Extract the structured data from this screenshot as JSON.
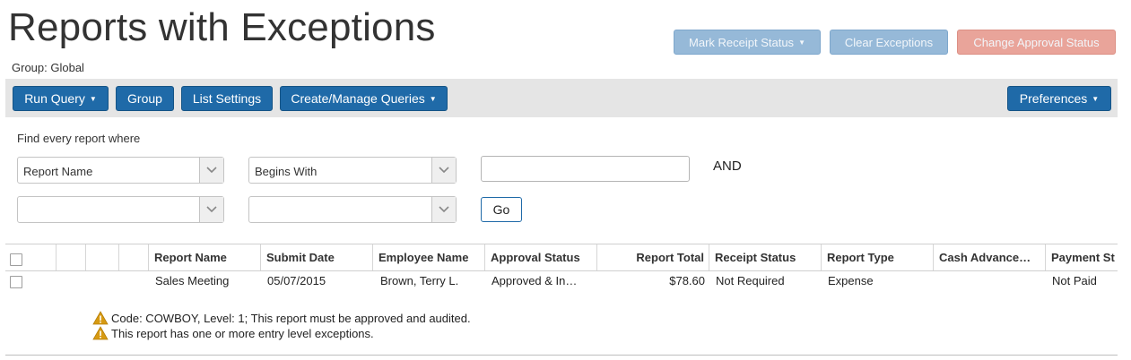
{
  "page": {
    "title": "Reports with Exceptions",
    "group_label": "Group: Global"
  },
  "header_actions": {
    "mark_receipt_status": "Mark Receipt Status",
    "clear_exceptions": "Clear Exceptions",
    "change_approval_status": "Change Approval Status"
  },
  "toolbar": {
    "run_query": "Run Query",
    "group": "Group",
    "list_settings": "List Settings",
    "create_manage_queries": "Create/Manage Queries",
    "preferences": "Preferences"
  },
  "query": {
    "find_label": "Find every report where",
    "row1": {
      "field": "Report Name",
      "operator": "Begins With",
      "value": "",
      "conjunction": "AND"
    },
    "row2": {
      "field": "",
      "operator": ""
    },
    "go_label": "Go"
  },
  "table": {
    "headers": [
      "Report Name",
      "Submit Date",
      "Employee Name",
      "Approval Status",
      "Report Total",
      "Receipt Status",
      "Report Type",
      "Cash Advance…",
      "Payment St"
    ],
    "rows": [
      {
        "report_name": "Sales Meeting",
        "submit_date": "05/07/2015",
        "employee_name": "Brown, Terry L.",
        "approval_status": "Approved & In…",
        "report_total": "$78.60",
        "receipt_status": "Not Required",
        "report_type": "Expense",
        "cash_advance": "",
        "payment_status": "Not Paid"
      }
    ],
    "exceptions": [
      "Code: COWBOY, Level: 1; This report must be approved and audited.",
      "This report has one or more entry level exceptions."
    ]
  },
  "colors": {
    "primary_button": "#1f6aa8",
    "disabled_blue_button": "#96b9d8",
    "disabled_red_button": "#e9a49a",
    "toolbar_bg": "#e5e5e5",
    "warning_icon": "#d79a12"
  },
  "icons": {
    "dropdown": "chevron-down-icon",
    "caret": "caret-down-icon",
    "warning": "warning-triangle-icon"
  }
}
